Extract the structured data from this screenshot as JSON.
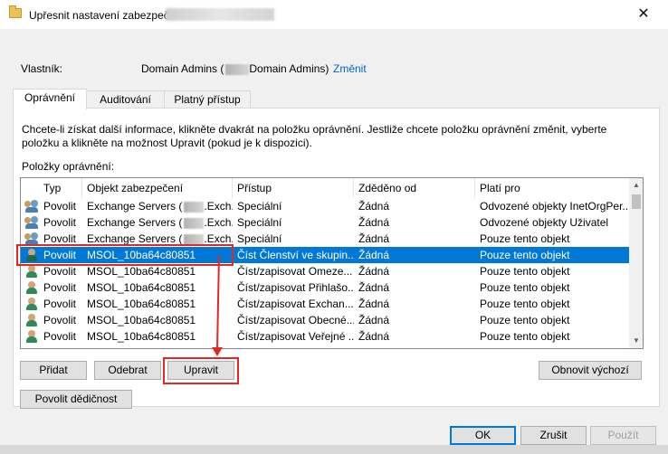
{
  "window": {
    "title": "Upřesnit nastavení zabezpečení",
    "close_glyph": "✕"
  },
  "owner": {
    "label": "Vlastník:",
    "value_prefix": "Domain Admins (",
    "value_suffix": "Domain Admins)",
    "change_link": "Změnit"
  },
  "tabs": [
    {
      "label": "Oprávnění",
      "active": true
    },
    {
      "label": "Auditování",
      "active": false
    },
    {
      "label": "Platný přístup",
      "active": false
    }
  ],
  "description": "Chcete-li získat další informace, klikněte dvakrát na položku oprávnění. Jestliže chcete položku oprávnění změnit, vyberte položku a klikněte na možnost Upravit (pokud je k dispozici).",
  "entries_label": "Položky oprávnění:",
  "list": {
    "columns": [
      "Typ",
      "Objekt zabezpečení",
      "Přístup",
      "Zděděno od",
      "Platí pro"
    ],
    "rows": [
      {
        "icon": "group-icon",
        "type": "Povolit",
        "principal": "Exchange Servers (",
        "principal_suffix": ".Exch...",
        "access": "Speciální",
        "inherited": "Žádná",
        "applies": "Odvozené objekty InetOrgPer...",
        "selected": false
      },
      {
        "icon": "group-icon",
        "type": "Povolit",
        "principal": "Exchange Servers (",
        "principal_suffix": ".Exch...",
        "access": "Speciální",
        "inherited": "Žádná",
        "applies": "Odvozené objekty Uživatel",
        "selected": false
      },
      {
        "icon": "group-icon",
        "type": "Povolit",
        "principal": "Exchange Servers (",
        "principal_suffix": ".Exch...",
        "access": "Speciální",
        "inherited": "Žádná",
        "applies": "Pouze tento objekt",
        "selected": false
      },
      {
        "icon": "user-icon",
        "type": "Povolit",
        "principal": "MSOL_10ba64c80851",
        "principal_suffix": "",
        "access": "Číst Členství ve skupin...",
        "inherited": "Žádná",
        "applies": "Pouze tento objekt",
        "selected": true
      },
      {
        "icon": "user-icon",
        "type": "Povolit",
        "principal": "MSOL_10ba64c80851",
        "principal_suffix": "",
        "access": "Číst/zapisovat Omeze...",
        "inherited": "Žádná",
        "applies": "Pouze tento objekt",
        "selected": false
      },
      {
        "icon": "user-icon",
        "type": "Povolit",
        "principal": "MSOL_10ba64c80851",
        "principal_suffix": "",
        "access": "Číst/zapisovat Přihlašo...",
        "inherited": "Žádná",
        "applies": "Pouze tento objekt",
        "selected": false
      },
      {
        "icon": "user-icon",
        "type": "Povolit",
        "principal": "MSOL_10ba64c80851",
        "principal_suffix": "",
        "access": "Číst/zapisovat Exchan...",
        "inherited": "Žádná",
        "applies": "Pouze tento objekt",
        "selected": false
      },
      {
        "icon": "user-icon",
        "type": "Povolit",
        "principal": "MSOL_10ba64c80851",
        "principal_suffix": "",
        "access": "Číst/zapisovat Obecné...",
        "inherited": "Žádná",
        "applies": "Pouze tento objekt",
        "selected": false
      },
      {
        "icon": "user-icon",
        "type": "Povolit",
        "principal": "MSOL_10ba64c80851",
        "principal_suffix": "",
        "access": "Číst/zapisovat Veřejné ...",
        "inherited": "Žádná",
        "applies": "Pouze tento objekt",
        "selected": false
      }
    ]
  },
  "buttons": {
    "add": "Přidat",
    "remove": "Odebrat",
    "edit": "Upravit",
    "restore_defaults": "Obnovit výchozí",
    "enable_inheritance": "Povolit dědičnost",
    "ok": "OK",
    "cancel": "Zrušit",
    "apply": "Použít"
  },
  "colors": {
    "selection": "#0078d7",
    "annotation": "#e32626",
    "link": "#0066cc"
  }
}
